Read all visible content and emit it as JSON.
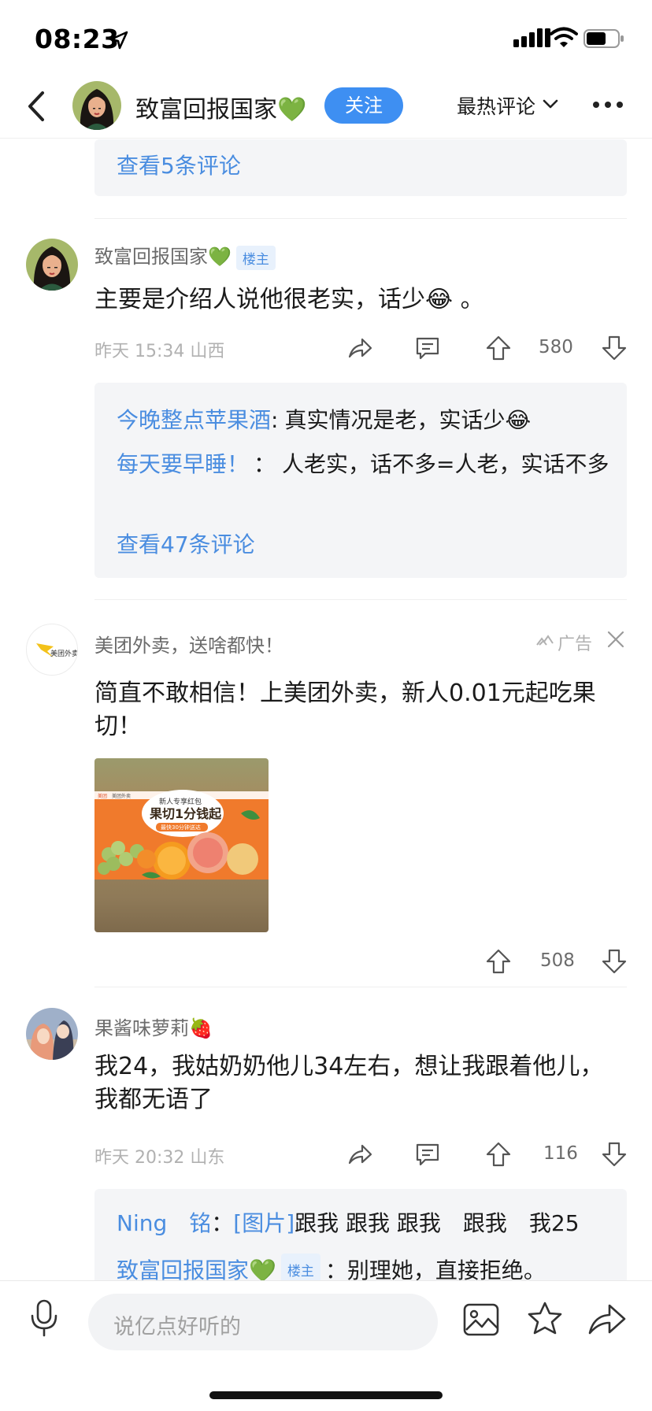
{
  "status_bar": {
    "time": "08:23"
  },
  "header": {
    "name": "致富回报国家💚",
    "follow_label": "关注",
    "sort_label": "最热评论"
  },
  "top_fragment": {
    "view_more": "查看5条评论"
  },
  "comments": [
    {
      "user": "致富回报国家💚",
      "badge": "楼主",
      "text": "主要是介绍人说他很老实，话少😂 。",
      "time_loc": "昨天 15:34 山西",
      "likes": "580",
      "replies": [
        {
          "user": "今晚整点苹果酒",
          "sep": ":",
          "text": "真实情况是老，实话少😂"
        },
        {
          "user": "每天要早睡！",
          "sep": "：",
          "text": "人老实，话不多=人老，实话不多"
        }
      ],
      "view_more": "查看47条评论"
    },
    {
      "user": "果酱味萝莉🍓",
      "text": "我24，我姑奶奶他儿34左右，想让我跟着他儿，我都无语了",
      "time_loc": "昨天 20:32 山东",
      "likes": "116",
      "replies": [
        {
          "user": "Ning　铭",
          "sep": "：",
          "text_link": "[图片]",
          "text": "跟我 跟我 跟我　跟我　我25"
        },
        {
          "user": "致富回报国家💚",
          "badge": "楼主",
          "sep": "：",
          "text": "别理她，直接拒绝。"
        }
      ]
    }
  ],
  "ad": {
    "advertiser": "美团外卖，送啥都快！",
    "ad_label": "广告",
    "logo_text": "美团外卖",
    "text": "简直不敢相信！上美团外卖，新人0.01元起吃果切！",
    "image": {
      "brand_left": "美团",
      "brand_right": "美团外卖",
      "headline_small": "新人专享红包",
      "headline": "果切1分钱起",
      "subline": "最快30分钟送达"
    },
    "likes": "508"
  },
  "bottom_bar": {
    "input_placeholder": "说亿点好听的"
  },
  "colors": {
    "accent": "#3e8ff2",
    "link": "#4a8de0",
    "subbox_bg": "#f4f5f7"
  }
}
